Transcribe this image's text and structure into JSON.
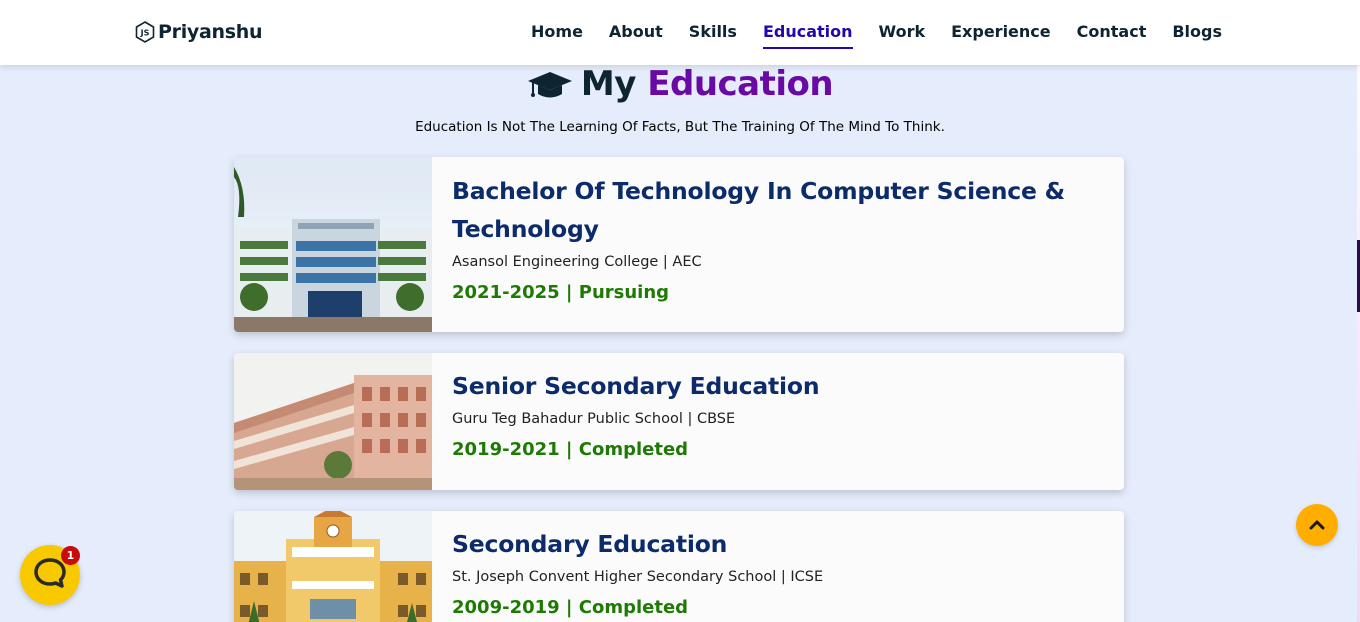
{
  "brand": {
    "name": "Priyanshu",
    "icon": "nodejs-icon"
  },
  "nav": {
    "items": [
      {
        "label": "Home"
      },
      {
        "label": "About"
      },
      {
        "label": "Skills"
      },
      {
        "label": "Education",
        "active": true
      },
      {
        "label": "Work"
      },
      {
        "label": "Experience"
      },
      {
        "label": "Contact"
      },
      {
        "label": "Blogs"
      }
    ]
  },
  "section": {
    "title_prefix": "My",
    "title_accent": "Education",
    "icon": "graduation-cap-icon",
    "quote": "Education Is Not The Learning Of Facts, But The Training Of The Mind To Think."
  },
  "education": [
    {
      "title": "Bachelor Of Technology In Computer Science & Technology",
      "school": "Asansol Engineering College | AEC",
      "year": "2021-2025 | Pursuing"
    },
    {
      "title": "Senior Secondary Education",
      "school": "Guru Teg Bahadur Public School | CBSE",
      "year": "2019-2021 | Completed"
    },
    {
      "title": "Secondary Education",
      "school": "St. Joseph Convent Higher Secondary School | ICSE",
      "year": "2009-2019 | Completed"
    }
  ],
  "chat": {
    "badge": "1",
    "icon": "chat-bubble-icon"
  },
  "scroll_top": {
    "icon": "chevron-up-icon"
  },
  "colors": {
    "background": "#e5ecfb",
    "accent": "#6a0aa5",
    "nav_active": "#2506ad",
    "title": "#0c2b6b",
    "year": "#1e7a05",
    "chat": "#f9c900",
    "scroll_top": "#ffae00"
  }
}
